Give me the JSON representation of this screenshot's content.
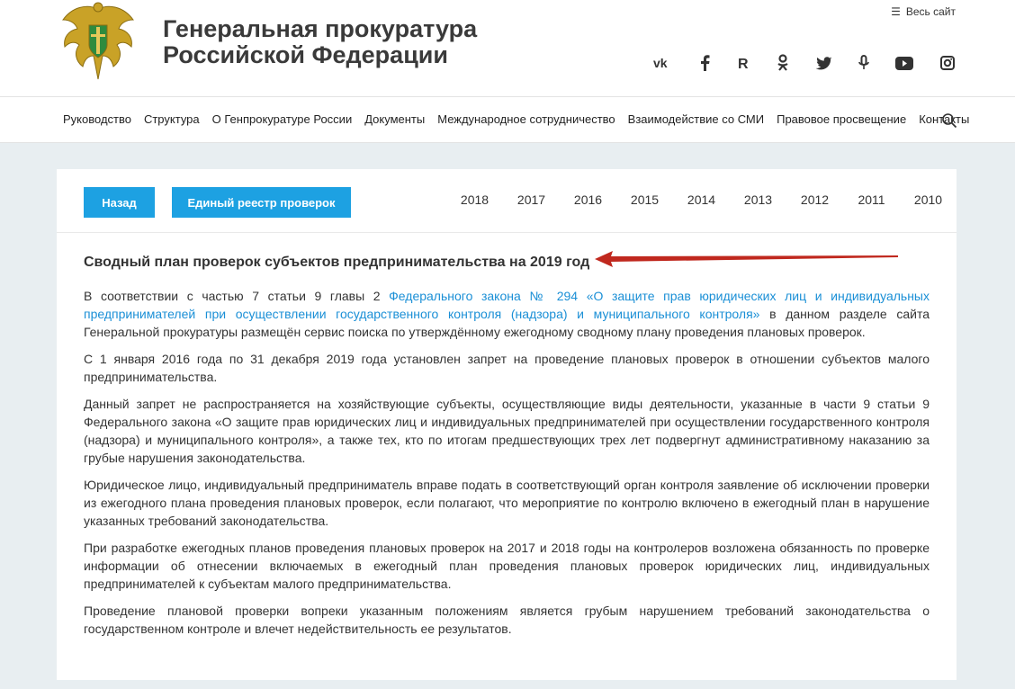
{
  "header": {
    "title_line1": "Генеральная прокуратура",
    "title_line2": "Российской Федерации",
    "all_site": "Весь сайт",
    "socials": [
      "vk-icon",
      "facebook-icon",
      "rutube-icon",
      "odnoklassniki-icon",
      "twitter-icon",
      "podcast-icon",
      "youtube-icon",
      "instagram-icon"
    ]
  },
  "nav": {
    "items": [
      "Руководство",
      "Структура",
      "О Генпрокуратуре России",
      "Документы",
      "Международное сотрудничество",
      "Взаимодействие со СМИ",
      "Правовое просвещение",
      "Контакты"
    ]
  },
  "toolbar": {
    "back_label": "Назад",
    "registry_label": "Единый реестр проверок",
    "years": [
      "2018",
      "2017",
      "2016",
      "2015",
      "2014",
      "2013",
      "2012",
      "2011",
      "2010"
    ]
  },
  "article": {
    "title": "Сводный план проверок субъектов предпринимательства на 2019 год",
    "p1_before": "В соответствии с частью 7 статьи 9 главы 2 ",
    "p1_link": "Федерального закона № 294 «О защите прав юридических лиц и индивидуальных предпринимателей при осуществлении государственного контроля (надзора) и муниципального контроля»",
    "p1_after": " в данном разделе сайта Генеральной прокуратуры размещён сервис поиска по утверждённому ежегодному сводному плану проведения плановых проверок.",
    "p2": "С 1 января 2016 года по 31 декабря 2019 года установлен запрет на проведение плановых проверок в отношении субъектов малого предпринимательства.",
    "p3": "Данный запрет не распространяется на хозяйствующие субъекты, осуществляющие виды деятельности, указанные в части 9 статьи 9 Федерального закона «О защите прав юридических лиц и индивидуальных предпринимателей при осуществлении государственного контроля (надзора) и муниципального контроля», а также тех, кто по итогам предшествующих трех лет подвергнут административному наказанию за грубые нарушения законодательства.",
    "p4": "Юридическое лицо, индивидуальный предприниматель вправе подать в соответствующий орган контроля заявление об исключении проверки из ежегодного плана проведения плановых проверок, если полагают, что мероприятие по контролю включено в ежегодный план в нарушение указанных требований законодательства.",
    "p5": "При разработке ежегодных планов проведения плановых проверок на 2017 и 2018 годы на контролеров возложена обязанность по проверке информации об отнесении включаемых в ежегодный план проведения плановых проверок юридических лиц, индивидуальных предпринимателей к субъектам малого предпринимательства.",
    "p6": "Проведение плановой проверки вопреки указанным положениям является грубым нарушением требований законодательства о государственном контроле и влечет недействительность ее результатов."
  },
  "colors": {
    "accent": "#1da1e2",
    "link": "#1a8fd6",
    "arrow": "#c0281e",
    "background": "#e8eef1"
  }
}
